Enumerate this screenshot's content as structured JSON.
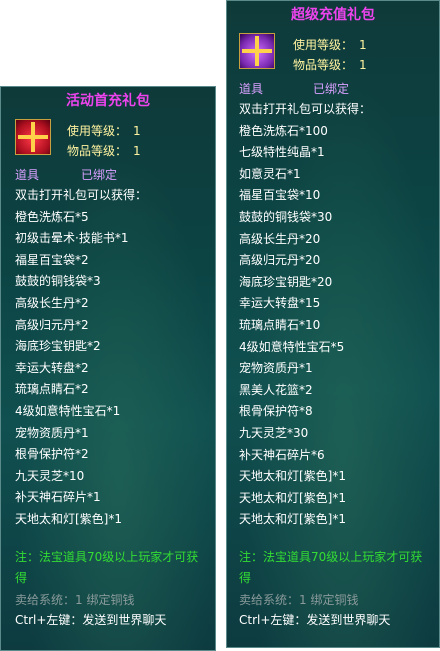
{
  "left": {
    "title": "活动首充礼包",
    "use_level_label": "使用等级：",
    "use_level": "1",
    "item_level_label": "物品等级：",
    "item_level": "1",
    "type": "道具",
    "bound": "已绑定",
    "intro": "双击打开礼包可以获得：",
    "items": [
      "橙色洗炼石*5",
      "初级击晕术·技能书*1",
      "福星百宝袋*2",
      "鼓鼓的铜钱袋*3",
      "高级长生丹*2",
      "高级归元丹*2",
      "海底珍宝钥匙*2",
      "幸运大转盘*2",
      "琉璃点睛石*2",
      "4级如意特性宝石*1",
      "宠物资质丹*1",
      "根骨保护符*2",
      "九天灵芝*10",
      "补天神石碎片*1",
      "天地太和灯[紫色]*1"
    ],
    "note": "注：法宝道具70级以上玩家才可获得",
    "sell": "卖给系统：1 绑定铜钱",
    "ctrl": "Ctrl+左键：发送到世界聊天"
  },
  "right": {
    "title": "超级充值礼包",
    "use_level_label": "使用等级：",
    "use_level": "1",
    "item_level_label": "物品等级：",
    "item_level": "1",
    "type": "道具",
    "bound": "已绑定",
    "intro": "双击打开礼包可以获得：",
    "items": [
      "橙色洗炼石*100",
      "七级特性纯晶*1",
      "如意灵石*1",
      "福星百宝袋*10",
      "鼓鼓的铜钱袋*30",
      "高级长生丹*20",
      "高级归元丹*20",
      "海底珍宝钥匙*20",
      "幸运大转盘*15",
      "琉璃点睛石*10",
      "4级如意特性宝石*5",
      "宠物资质丹*1",
      "黑美人花篮*2",
      "根骨保护符*8",
      "九天灵芝*30",
      "补天神石碎片*6",
      "天地太和灯[紫色]*1",
      "天地太和灯[紫色]*1",
      "天地太和灯[紫色]*1"
    ],
    "note": "注：法宝道具70级以上玩家才可获得",
    "sell": "卖给系统：1 绑定铜钱",
    "ctrl": "Ctrl+左键：发送到世界聊天"
  },
  "colors": {
    "title": "#ee44ee",
    "level_text": "#fff3a0",
    "type_text": "#d9a0ff",
    "note": "#33dd33",
    "sell": "#8a9a9a"
  },
  "icons": {
    "left_item": "red-gift-box-icon",
    "right_item": "purple-gift-box-icon"
  }
}
